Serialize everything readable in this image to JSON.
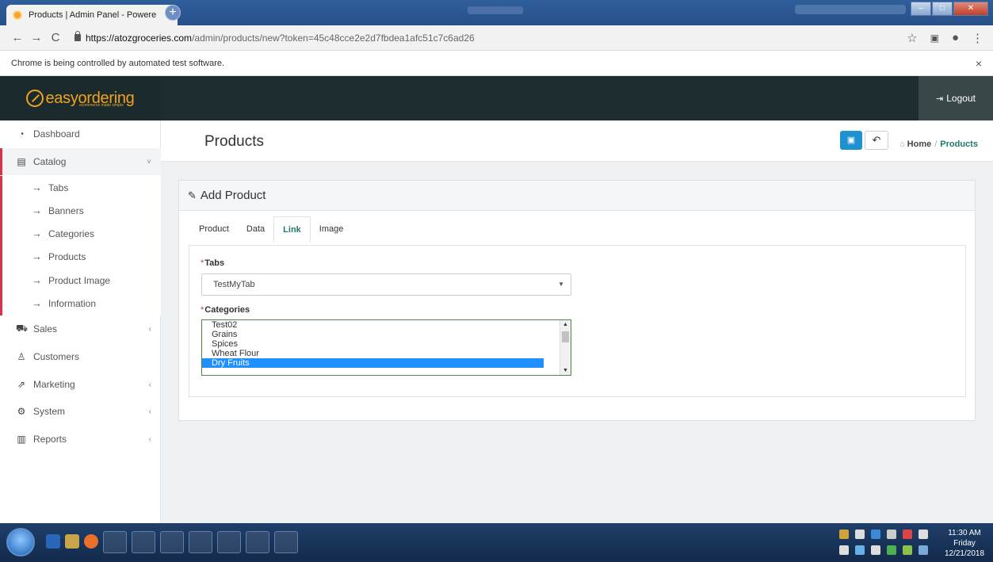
{
  "browser": {
    "tab_title": "Products | Admin Panel - Powere",
    "tab_close": "×",
    "new_tab": "+",
    "url_host": "https://atozgroceries.com",
    "url_path": "/admin/products/new?token=45c48cce2e2d7fbdea1afc51c7c6ad26",
    "infobar_text": "Chrome is being controlled by automated test software.",
    "infobar_close": "×"
  },
  "header": {
    "logo_text": "easyordering",
    "logo_tagline": "ecommerce made simple",
    "logout_label": "Logout"
  },
  "sidebar": {
    "items": [
      {
        "label": "Dashboard",
        "icon": "dashboard-icon"
      },
      {
        "label": "Catalog",
        "icon": "catalog-icon",
        "chevron": "˅"
      },
      {
        "label": "Sales",
        "icon": "cart-icon",
        "chevron": "‹"
      },
      {
        "label": "Customers",
        "icon": "user-icon"
      },
      {
        "label": "Marketing",
        "icon": "share-icon",
        "chevron": "‹"
      },
      {
        "label": "System",
        "icon": "gear-icon",
        "chevron": "‹"
      },
      {
        "label": "Reports",
        "icon": "bar-chart-icon",
        "chevron": "‹"
      }
    ],
    "catalog_sub": [
      "Tabs",
      "Banners",
      "Categories",
      "Products",
      "Product Image",
      "Information"
    ]
  },
  "page": {
    "title": "Products",
    "breadcrumb_home": "Home",
    "breadcrumb_sep": "/",
    "breadcrumb_current": "Products",
    "panel_title": "Add Product",
    "tabs": [
      "Product",
      "Data",
      "Link",
      "Image"
    ],
    "active_tab": "Link",
    "tabs_field": {
      "label": "Tabs",
      "value": "TestMyTab"
    },
    "categories_field": {
      "label": "Categories",
      "options": [
        "Test02",
        "Grains",
        "Spices",
        "Wheat Flour",
        "Dry Fruits"
      ],
      "selected": "Dry Fruits"
    }
  },
  "taskbar": {
    "time": "11:30 AM",
    "day": "Friday",
    "date": "12/21/2018"
  },
  "colors": {
    "accent": "#1e7a6e",
    "danger": "#d9334b",
    "primary": "#1e91cf",
    "header_bg": "#1e2e30",
    "logo": "#f0a31f"
  }
}
